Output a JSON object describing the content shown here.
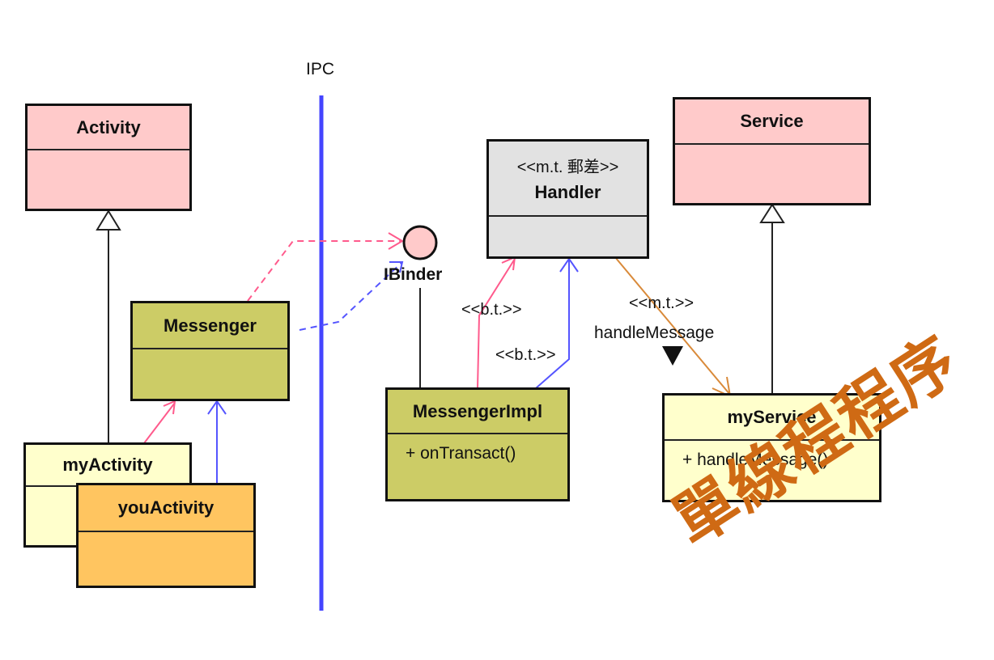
{
  "ipc_label": "IPC",
  "classes": {
    "activity": {
      "name": "Activity"
    },
    "messenger": {
      "name": "Messenger"
    },
    "my_activity": {
      "name": "myActivity"
    },
    "you_activity": {
      "name": "youActivity"
    },
    "handler": {
      "stereotype": "<<m.t. 郵差>>",
      "name": "Handler"
    },
    "messenger_impl": {
      "name": "MessengerImpl",
      "method": "+ onTransact()"
    },
    "service": {
      "name": "Service"
    },
    "my_service": {
      "name": "myService",
      "method": "+ handleMessage()"
    }
  },
  "interface": {
    "name": "IBinder"
  },
  "edge_labels": {
    "bt_pink": "<<b.t.>>",
    "bt_blue": "<<b.t.>>",
    "mt": "<<m.t.>>",
    "handle_message": "handleMessage"
  },
  "watermark": "單線程程序",
  "colors": {
    "pink_class": "#ffcaca",
    "olive_class": "#cccc66",
    "yellow_class": "#ffffcc",
    "orange_class": "#ffc560",
    "gray_class": "#e2e2e2",
    "ipc_line": "#4444ff",
    "pink_arrow": "#ff5a8c",
    "blue_arrow": "#5555ff",
    "orange_arrow": "#d98a3a",
    "watermark": "#cf6a14"
  }
}
